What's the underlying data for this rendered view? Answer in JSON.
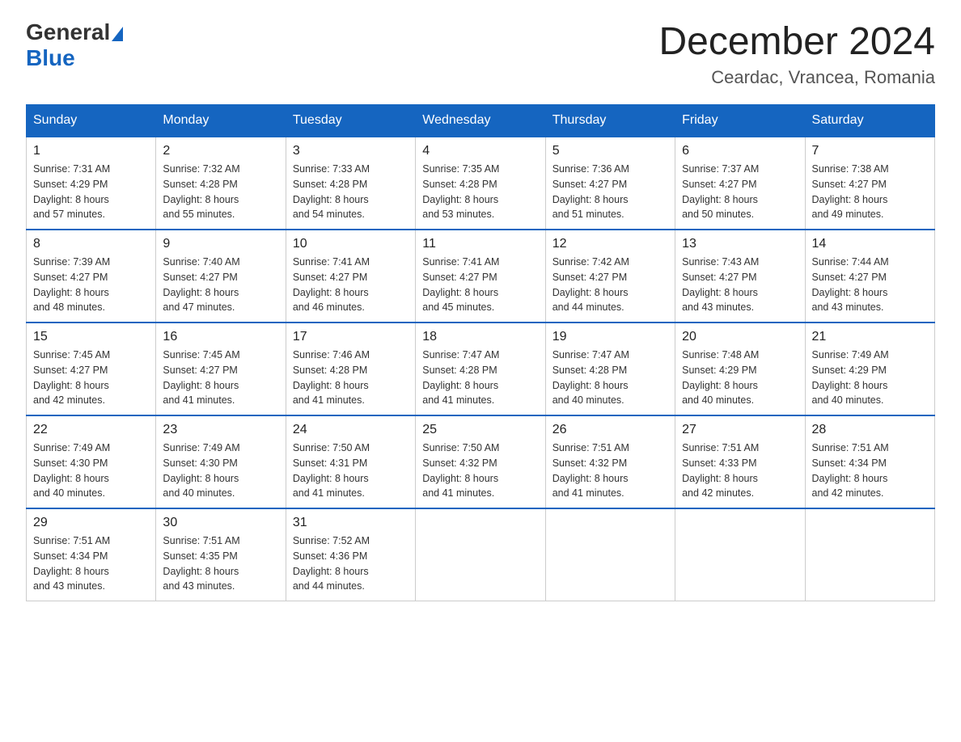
{
  "logo": {
    "general": "General",
    "blue": "Blue"
  },
  "title": "December 2024",
  "location": "Ceardac, Vrancea, Romania",
  "days_of_week": [
    "Sunday",
    "Monday",
    "Tuesday",
    "Wednesday",
    "Thursday",
    "Friday",
    "Saturday"
  ],
  "weeks": [
    [
      {
        "num": "1",
        "sunrise": "7:31 AM",
        "sunset": "4:29 PM",
        "daylight": "8 hours and 57 minutes."
      },
      {
        "num": "2",
        "sunrise": "7:32 AM",
        "sunset": "4:28 PM",
        "daylight": "8 hours and 55 minutes."
      },
      {
        "num": "3",
        "sunrise": "7:33 AM",
        "sunset": "4:28 PM",
        "daylight": "8 hours and 54 minutes."
      },
      {
        "num": "4",
        "sunrise": "7:35 AM",
        "sunset": "4:28 PM",
        "daylight": "8 hours and 53 minutes."
      },
      {
        "num": "5",
        "sunrise": "7:36 AM",
        "sunset": "4:27 PM",
        "daylight": "8 hours and 51 minutes."
      },
      {
        "num": "6",
        "sunrise": "7:37 AM",
        "sunset": "4:27 PM",
        "daylight": "8 hours and 50 minutes."
      },
      {
        "num": "7",
        "sunrise": "7:38 AM",
        "sunset": "4:27 PM",
        "daylight": "8 hours and 49 minutes."
      }
    ],
    [
      {
        "num": "8",
        "sunrise": "7:39 AM",
        "sunset": "4:27 PM",
        "daylight": "8 hours and 48 minutes."
      },
      {
        "num": "9",
        "sunrise": "7:40 AM",
        "sunset": "4:27 PM",
        "daylight": "8 hours and 47 minutes."
      },
      {
        "num": "10",
        "sunrise": "7:41 AM",
        "sunset": "4:27 PM",
        "daylight": "8 hours and 46 minutes."
      },
      {
        "num": "11",
        "sunrise": "7:41 AM",
        "sunset": "4:27 PM",
        "daylight": "8 hours and 45 minutes."
      },
      {
        "num": "12",
        "sunrise": "7:42 AM",
        "sunset": "4:27 PM",
        "daylight": "8 hours and 44 minutes."
      },
      {
        "num": "13",
        "sunrise": "7:43 AM",
        "sunset": "4:27 PM",
        "daylight": "8 hours and 43 minutes."
      },
      {
        "num": "14",
        "sunrise": "7:44 AM",
        "sunset": "4:27 PM",
        "daylight": "8 hours and 43 minutes."
      }
    ],
    [
      {
        "num": "15",
        "sunrise": "7:45 AM",
        "sunset": "4:27 PM",
        "daylight": "8 hours and 42 minutes."
      },
      {
        "num": "16",
        "sunrise": "7:45 AM",
        "sunset": "4:27 PM",
        "daylight": "8 hours and 41 minutes."
      },
      {
        "num": "17",
        "sunrise": "7:46 AM",
        "sunset": "4:28 PM",
        "daylight": "8 hours and 41 minutes."
      },
      {
        "num": "18",
        "sunrise": "7:47 AM",
        "sunset": "4:28 PM",
        "daylight": "8 hours and 41 minutes."
      },
      {
        "num": "19",
        "sunrise": "7:47 AM",
        "sunset": "4:28 PM",
        "daylight": "8 hours and 40 minutes."
      },
      {
        "num": "20",
        "sunrise": "7:48 AM",
        "sunset": "4:29 PM",
        "daylight": "8 hours and 40 minutes."
      },
      {
        "num": "21",
        "sunrise": "7:49 AM",
        "sunset": "4:29 PM",
        "daylight": "8 hours and 40 minutes."
      }
    ],
    [
      {
        "num": "22",
        "sunrise": "7:49 AM",
        "sunset": "4:30 PM",
        "daylight": "8 hours and 40 minutes."
      },
      {
        "num": "23",
        "sunrise": "7:49 AM",
        "sunset": "4:30 PM",
        "daylight": "8 hours and 40 minutes."
      },
      {
        "num": "24",
        "sunrise": "7:50 AM",
        "sunset": "4:31 PM",
        "daylight": "8 hours and 41 minutes."
      },
      {
        "num": "25",
        "sunrise": "7:50 AM",
        "sunset": "4:32 PM",
        "daylight": "8 hours and 41 minutes."
      },
      {
        "num": "26",
        "sunrise": "7:51 AM",
        "sunset": "4:32 PM",
        "daylight": "8 hours and 41 minutes."
      },
      {
        "num": "27",
        "sunrise": "7:51 AM",
        "sunset": "4:33 PM",
        "daylight": "8 hours and 42 minutes."
      },
      {
        "num": "28",
        "sunrise": "7:51 AM",
        "sunset": "4:34 PM",
        "daylight": "8 hours and 42 minutes."
      }
    ],
    [
      {
        "num": "29",
        "sunrise": "7:51 AM",
        "sunset": "4:34 PM",
        "daylight": "8 hours and 43 minutes."
      },
      {
        "num": "30",
        "sunrise": "7:51 AM",
        "sunset": "4:35 PM",
        "daylight": "8 hours and 43 minutes."
      },
      {
        "num": "31",
        "sunrise": "7:52 AM",
        "sunset": "4:36 PM",
        "daylight": "8 hours and 44 minutes."
      },
      null,
      null,
      null,
      null
    ]
  ],
  "labels": {
    "sunrise": "Sunrise:",
    "sunset": "Sunset:",
    "daylight": "Daylight:"
  }
}
